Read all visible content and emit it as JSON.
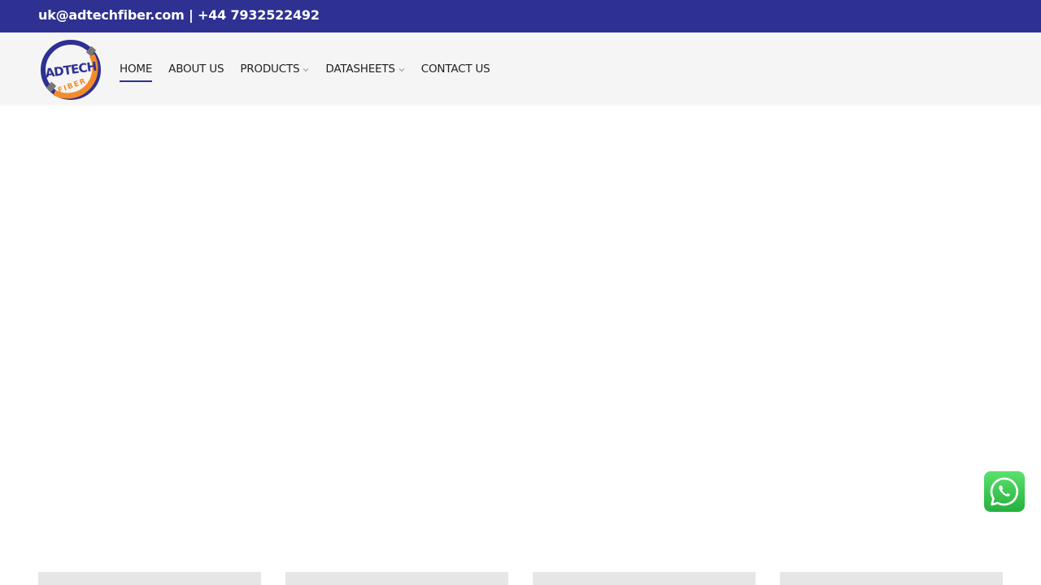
{
  "topbar": {
    "contact_text": "uk@adtechfiber.com | +44 7932522492"
  },
  "logo": {
    "alt": "ADTECH FIBER logo",
    "wordmark": "ADTECH",
    "subword": "FIBER"
  },
  "nav": {
    "items": [
      {
        "label": "HOME",
        "active": true,
        "has_dropdown": false
      },
      {
        "label": "ABOUT US",
        "active": false,
        "has_dropdown": false
      },
      {
        "label": "PRODUCTS",
        "active": false,
        "has_dropdown": true
      },
      {
        "label": "DATASHEETS",
        "active": false,
        "has_dropdown": true
      },
      {
        "label": "CONTACT US",
        "active": false,
        "has_dropdown": false
      }
    ]
  },
  "floating": {
    "whatsapp_icon": "whatsapp-icon"
  },
  "colors": {
    "topbar_bg": "#2e3192",
    "header_bg": "#f5f5f5",
    "accent": "#2e3192",
    "logo_orange": "#f28c28",
    "whatsapp_green": "#25d366"
  }
}
